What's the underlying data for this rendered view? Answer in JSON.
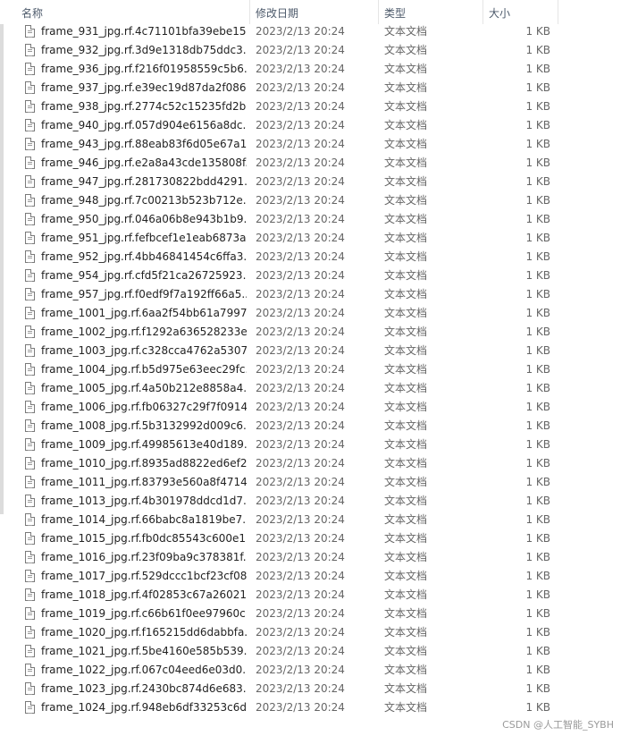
{
  "columns": {
    "name": "名称",
    "date": "修改日期",
    "type": "类型",
    "size": "大小"
  },
  "sort_indicator": "^",
  "files": [
    {
      "name": "frame_931_jpg.rf.4c71101bfa39ebe15...",
      "date": "2023/2/13 20:24",
      "type": "文本文档",
      "size": "1 KB"
    },
    {
      "name": "frame_932_jpg.rf.3d9e1318db75ddc3...",
      "date": "2023/2/13 20:24",
      "type": "文本文档",
      "size": "1 KB"
    },
    {
      "name": "frame_936_jpg.rf.f216f01958559c5b6...",
      "date": "2023/2/13 20:24",
      "type": "文本文档",
      "size": "1 KB"
    },
    {
      "name": "frame_937_jpg.rf.e39ec19d87da2f086...",
      "date": "2023/2/13 20:24",
      "type": "文本文档",
      "size": "1 KB"
    },
    {
      "name": "frame_938_jpg.rf.2774c52c15235fd2b...",
      "date": "2023/2/13 20:24",
      "type": "文本文档",
      "size": "1 KB"
    },
    {
      "name": "frame_940_jpg.rf.057d904e6156a8dc...",
      "date": "2023/2/13 20:24",
      "type": "文本文档",
      "size": "1 KB"
    },
    {
      "name": "frame_943_jpg.rf.88eab83f6d05e67a1...",
      "date": "2023/2/13 20:24",
      "type": "文本文档",
      "size": "1 KB"
    },
    {
      "name": "frame_946_jpg.rf.e2a8a43cde135808f...",
      "date": "2023/2/13 20:24",
      "type": "文本文档",
      "size": "1 KB"
    },
    {
      "name": "frame_947_jpg.rf.281730822bdd4291...",
      "date": "2023/2/13 20:24",
      "type": "文本文档",
      "size": "1 KB"
    },
    {
      "name": "frame_948_jpg.rf.7c00213b523b712e...",
      "date": "2023/2/13 20:24",
      "type": "文本文档",
      "size": "1 KB"
    },
    {
      "name": "frame_950_jpg.rf.046a06b8e943b1b9...",
      "date": "2023/2/13 20:24",
      "type": "文本文档",
      "size": "1 KB"
    },
    {
      "name": "frame_951_jpg.rf.fefbcef1e1eab6873a...",
      "date": "2023/2/13 20:24",
      "type": "文本文档",
      "size": "1 KB"
    },
    {
      "name": "frame_952_jpg.rf.4bb46841454c6ffa3...",
      "date": "2023/2/13 20:24",
      "type": "文本文档",
      "size": "1 KB"
    },
    {
      "name": "frame_954_jpg.rf.cfd5f21ca26725923...",
      "date": "2023/2/13 20:24",
      "type": "文本文档",
      "size": "1 KB"
    },
    {
      "name": "frame_957_jpg.rf.f0edf9f7a192ff66a5...",
      "date": "2023/2/13 20:24",
      "type": "文本文档",
      "size": "1 KB"
    },
    {
      "name": "frame_1001_jpg.rf.6aa2f54bb61a7997...",
      "date": "2023/2/13 20:24",
      "type": "文本文档",
      "size": "1 KB"
    },
    {
      "name": "frame_1002_jpg.rf.f1292a636528233e...",
      "date": "2023/2/13 20:24",
      "type": "文本文档",
      "size": "1 KB"
    },
    {
      "name": "frame_1003_jpg.rf.c328cca4762a5307...",
      "date": "2023/2/13 20:24",
      "type": "文本文档",
      "size": "1 KB"
    },
    {
      "name": "frame_1004_jpg.rf.b5d975e63eec29fc...",
      "date": "2023/2/13 20:24",
      "type": "文本文档",
      "size": "1 KB"
    },
    {
      "name": "frame_1005_jpg.rf.4a50b212e8858a4...",
      "date": "2023/2/13 20:24",
      "type": "文本文档",
      "size": "1 KB"
    },
    {
      "name": "frame_1006_jpg.rf.fb06327c29f7f0914...",
      "date": "2023/2/13 20:24",
      "type": "文本文档",
      "size": "1 KB"
    },
    {
      "name": "frame_1008_jpg.rf.5b3132992d009c6...",
      "date": "2023/2/13 20:24",
      "type": "文本文档",
      "size": "1 KB"
    },
    {
      "name": "frame_1009_jpg.rf.49985613e40d189...",
      "date": "2023/2/13 20:24",
      "type": "文本文档",
      "size": "1 KB"
    },
    {
      "name": "frame_1010_jpg.rf.8935ad8822ed6ef2...",
      "date": "2023/2/13 20:24",
      "type": "文本文档",
      "size": "1 KB"
    },
    {
      "name": "frame_1011_jpg.rf.83793e560a8f4714...",
      "date": "2023/2/13 20:24",
      "type": "文本文档",
      "size": "1 KB"
    },
    {
      "name": "frame_1013_jpg.rf.4b301978ddcd1d7...",
      "date": "2023/2/13 20:24",
      "type": "文本文档",
      "size": "1 KB"
    },
    {
      "name": "frame_1014_jpg.rf.66babc8a1819be7...",
      "date": "2023/2/13 20:24",
      "type": "文本文档",
      "size": "1 KB"
    },
    {
      "name": "frame_1015_jpg.rf.fb0dc85543c600e1...",
      "date": "2023/2/13 20:24",
      "type": "文本文档",
      "size": "1 KB"
    },
    {
      "name": "frame_1016_jpg.rf.23f09ba9c378381f...",
      "date": "2023/2/13 20:24",
      "type": "文本文档",
      "size": "1 KB"
    },
    {
      "name": "frame_1017_jpg.rf.529dccc1bcf23cf08...",
      "date": "2023/2/13 20:24",
      "type": "文本文档",
      "size": "1 KB"
    },
    {
      "name": "frame_1018_jpg.rf.4f02853c67a26021...",
      "date": "2023/2/13 20:24",
      "type": "文本文档",
      "size": "1 KB"
    },
    {
      "name": "frame_1019_jpg.rf.c66b61f0ee97960c...",
      "date": "2023/2/13 20:24",
      "type": "文本文档",
      "size": "1 KB"
    },
    {
      "name": "frame_1020_jpg.rf.f165215dd6dabbfa...",
      "date": "2023/2/13 20:24",
      "type": "文本文档",
      "size": "1 KB"
    },
    {
      "name": "frame_1021_jpg.rf.5be4160e585b539...",
      "date": "2023/2/13 20:24",
      "type": "文本文档",
      "size": "1 KB"
    },
    {
      "name": "frame_1022_jpg.rf.067c04eed6e03d0...",
      "date": "2023/2/13 20:24",
      "type": "文本文档",
      "size": "1 KB"
    },
    {
      "name": "frame_1023_jpg.rf.2430bc874d6e683...",
      "date": "2023/2/13 20:24",
      "type": "文本文档",
      "size": "1 KB"
    },
    {
      "name": "frame_1024_jpg.rf.948eb6df33253c6d...",
      "date": "2023/2/13 20:24",
      "type": "文本文档",
      "size": "1 KB"
    }
  ],
  "icon": "text-file-icon",
  "watermark": "CSDN @人工智能_SYBH"
}
